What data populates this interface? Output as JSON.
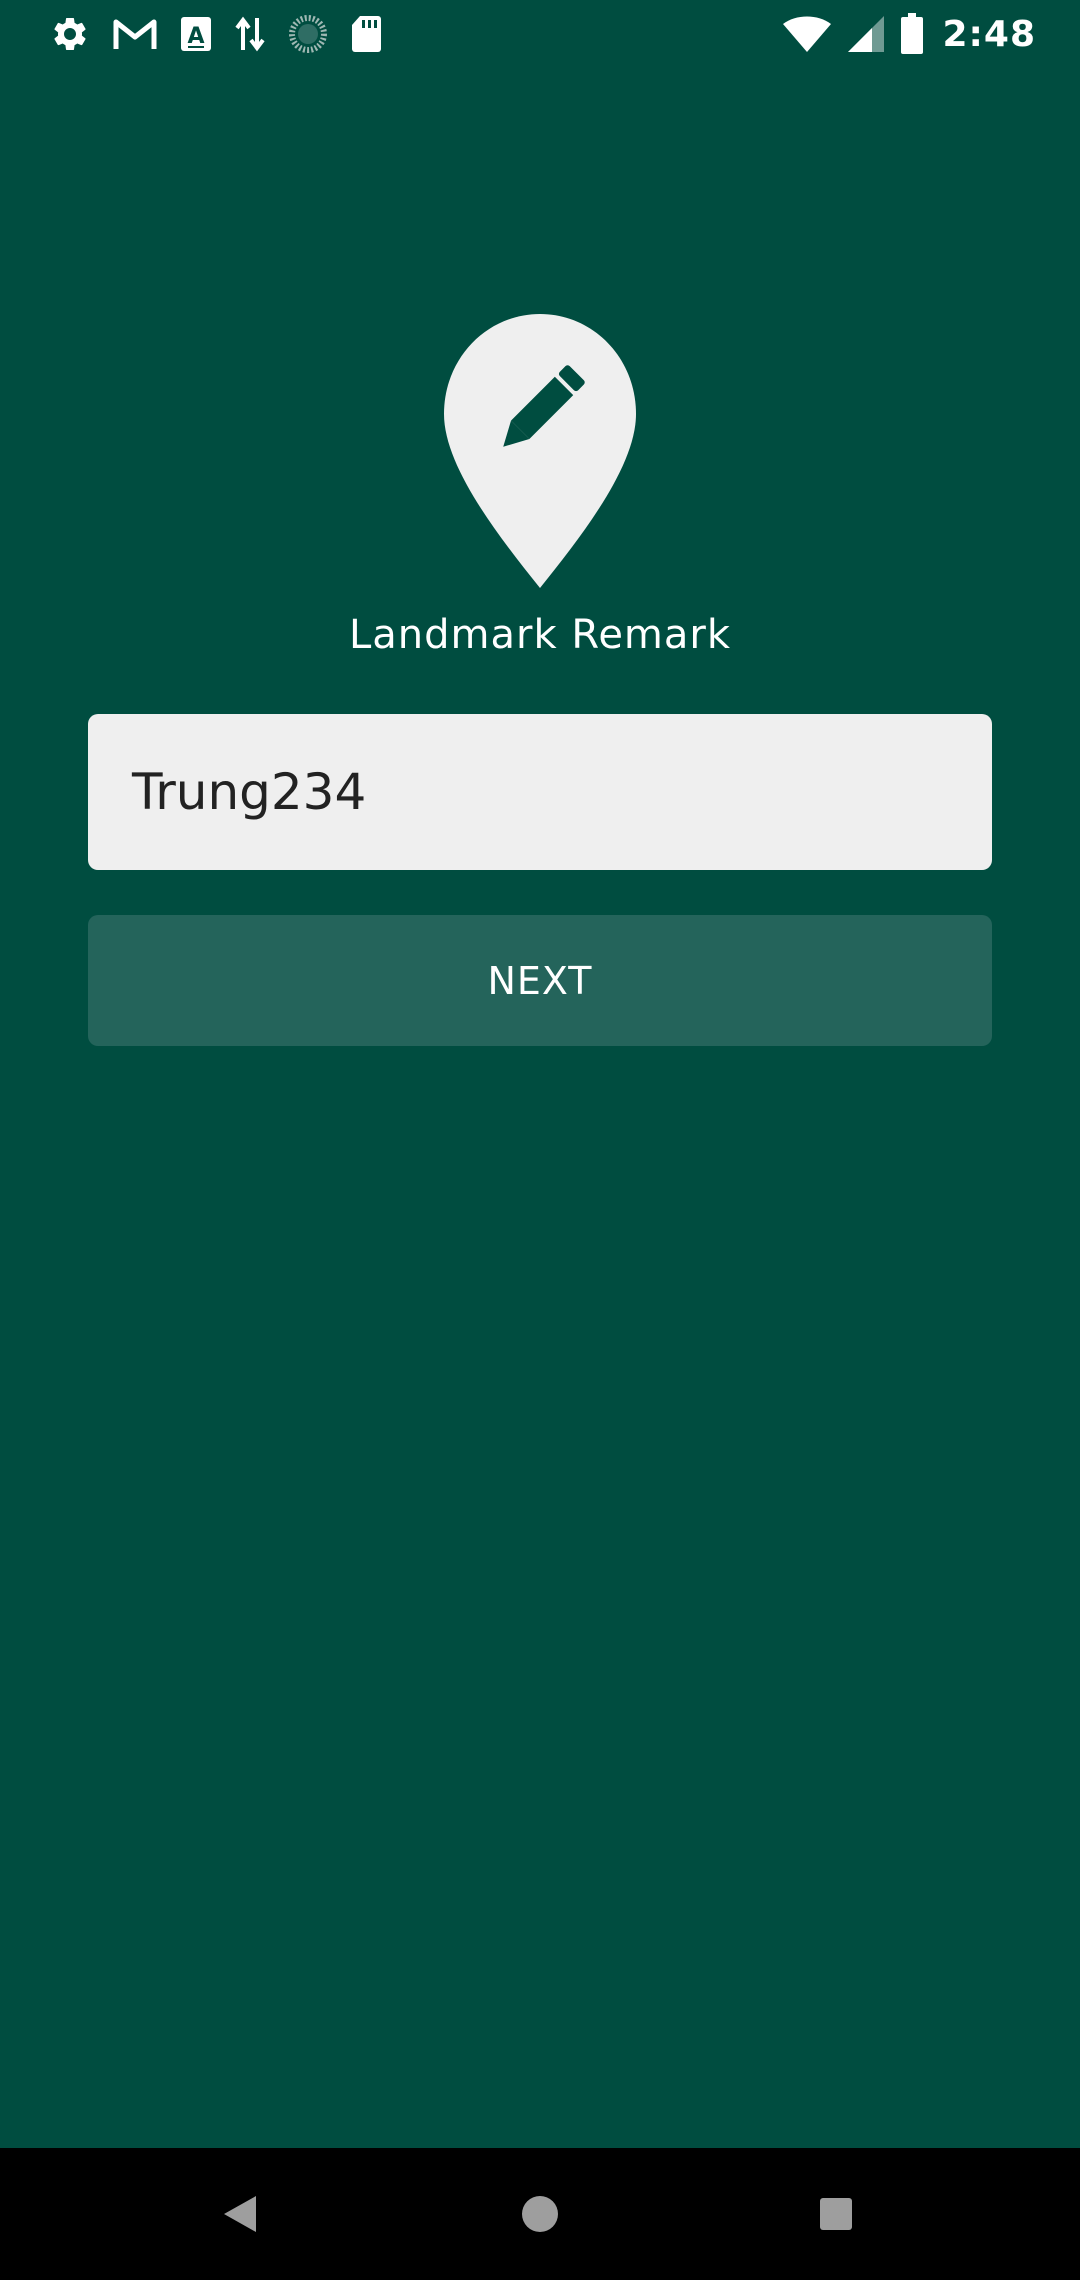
{
  "status_bar": {
    "left_icons": [
      "settings-icon",
      "gmail-icon",
      "text-a-icon",
      "data-transfer-icon",
      "sync-icon",
      "sd-card-icon"
    ],
    "right_icons": [
      "wifi-icon",
      "cellular-signal-icon",
      "battery-icon"
    ],
    "time": "2:48"
  },
  "app": {
    "logo_icon": "map-pin-pencil-icon",
    "title": "Landmark Remark"
  },
  "form": {
    "username_value": "Trung234",
    "next_label": "NEXT"
  },
  "nav_bar": {
    "buttons": [
      "back-icon",
      "home-icon",
      "recents-icon"
    ]
  },
  "colors": {
    "background": "#004d40",
    "field": "#efefef",
    "button": "#24645b"
  }
}
